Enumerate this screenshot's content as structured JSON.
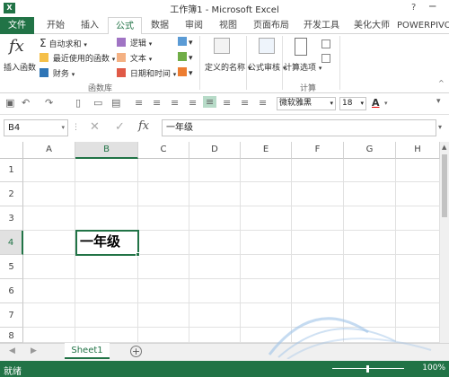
{
  "window": {
    "title": "工作簿1 - Microsoft Excel",
    "help": "?",
    "minimize": "─"
  },
  "tabs": [
    {
      "label": "文件",
      "id": "file"
    },
    {
      "label": "开始",
      "id": "home"
    },
    {
      "label": "插入",
      "id": "insert"
    },
    {
      "label": "公式",
      "id": "formulas"
    },
    {
      "label": "数据",
      "id": "data"
    },
    {
      "label": "审阅",
      "id": "review"
    },
    {
      "label": "视图",
      "id": "view"
    },
    {
      "label": "页面布局",
      "id": "pagelayout"
    },
    {
      "label": "开发工具",
      "id": "developer"
    },
    {
      "label": "美化大师",
      "id": "beautify"
    },
    {
      "label": "POWERPIVO",
      "id": "powerpivot"
    }
  ],
  "ribbon": {
    "insert_function": "插入函数",
    "autosum": "自动求和",
    "recent": "最近使用的函数",
    "financial": "财务",
    "logical": "逻辑",
    "text": "文本",
    "datetime": "日期和时间",
    "define_name": "定义的名称",
    "formula_audit": "公式审核",
    "calc_options": "计算选项",
    "group_library": "函数库",
    "group_calc": "计算",
    "fx_glyph": "fx"
  },
  "qat": {
    "font_name": "微软雅黑",
    "font_size": "18"
  },
  "formula_bar": {
    "name_box": "B4",
    "formula": "一年级"
  },
  "grid": {
    "columns": [
      "A",
      "B",
      "C",
      "D",
      "E",
      "F",
      "G",
      "H"
    ],
    "rows": [
      "1",
      "2",
      "3",
      "4",
      "5",
      "6",
      "7",
      "8"
    ],
    "selected_column": "B",
    "selected_row": "4",
    "active_cell_value": "一年级"
  },
  "sheets": [
    {
      "name": "Sheet1"
    }
  ],
  "status": {
    "ready": "就绪",
    "zoom": "100%"
  },
  "colors": {
    "accent": "#217346"
  }
}
